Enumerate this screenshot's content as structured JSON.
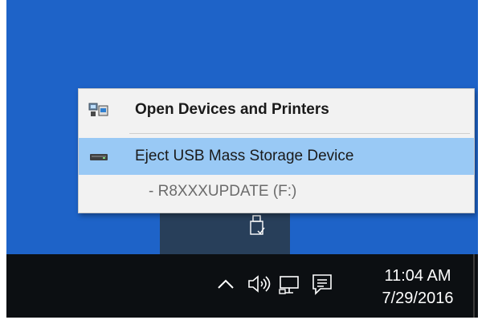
{
  "menu": {
    "open_devices_label": "Open Devices and Printers",
    "eject_label": "Eject USB Mass Storage Device",
    "drive_label": "-   R8XXXUPDATE (F:)"
  },
  "icons": {
    "open_devices": "devices-printers-icon",
    "eject": "drive-icon",
    "overflow_usb": "usb-drive-icon",
    "show_hidden": "chevron-up-icon",
    "volume": "speaker-icon",
    "network": "network-icon",
    "action_center": "action-center-icon"
  },
  "taskbar": {
    "time": "11:04 AM",
    "date": "7/29/2016"
  },
  "colors": {
    "desktop": "#1e63c8",
    "menu_bg": "#f2f2f2",
    "menu_highlight": "#99c9f5",
    "taskbar": "#0c0f12"
  }
}
